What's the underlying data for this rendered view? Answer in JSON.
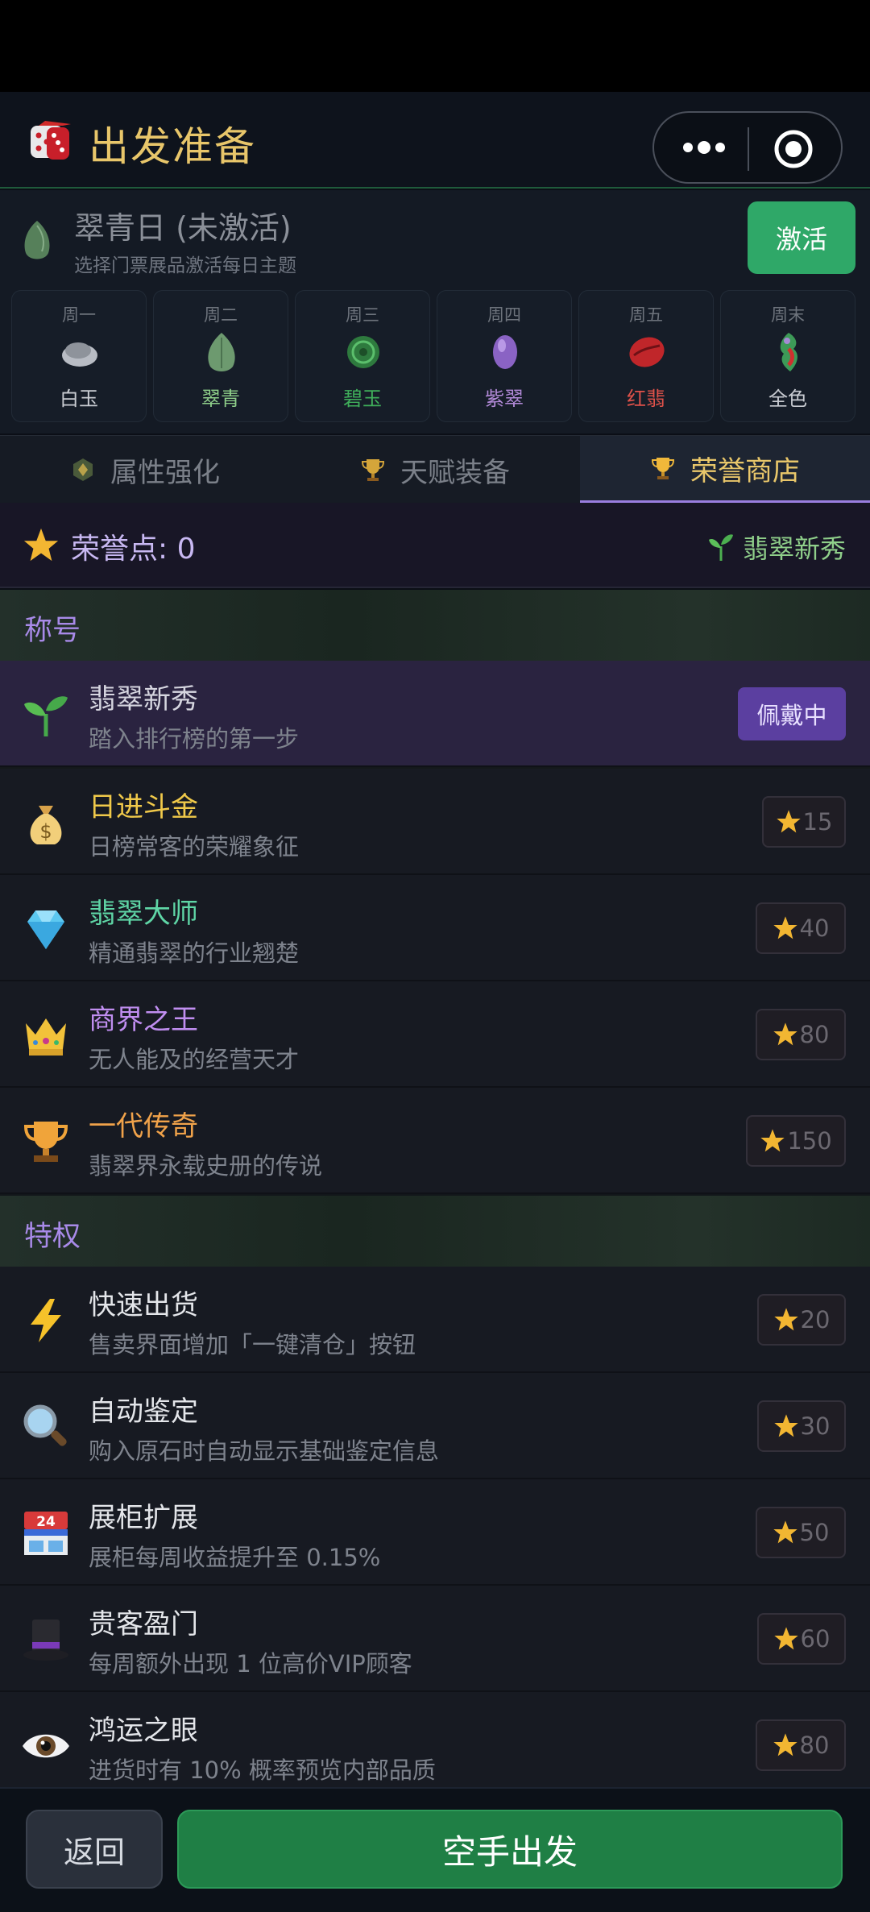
{
  "header": {
    "title": "出发准备"
  },
  "theme": {
    "name": "翠青日 (未激活)",
    "subtitle": "选择门票展品激活每日主题",
    "activate_label": "激活",
    "days": [
      {
        "day": "周一",
        "label": "白玉",
        "color": "#c9ccd2"
      },
      {
        "day": "周二",
        "label": "翠青",
        "color": "#8fcf8a"
      },
      {
        "day": "周三",
        "label": "碧玉",
        "color": "#3fae5a"
      },
      {
        "day": "周四",
        "label": "紫翠",
        "color": "#b28ad8"
      },
      {
        "day": "周五",
        "label": "红翡",
        "color": "#e0524a"
      },
      {
        "day": "周末",
        "label": "全色",
        "color": "#c9ccd2"
      }
    ]
  },
  "tabs": [
    {
      "label": "属性强化",
      "icon": "gear-gem-icon"
    },
    {
      "label": "天赋装备",
      "icon": "trophy-icon"
    },
    {
      "label": "荣誉商店",
      "icon": "trophy-icon",
      "active": true
    }
  ],
  "honor": {
    "points_label": "荣誉点: 0",
    "current_title": "翡翠新秀"
  },
  "titles_section": "称号",
  "titles": [
    {
      "name": "翡翠新秀",
      "desc": "踏入排行榜的第一步",
      "icon": "sprout-icon",
      "color": "#d6d6e0",
      "status": "佩戴中"
    },
    {
      "name": "日进斗金",
      "desc": "日榜常客的荣耀象征",
      "icon": "money-bag-icon",
      "color": "#f0c94a",
      "price": "15"
    },
    {
      "name": "翡翠大师",
      "desc": "精通翡翠的行业翘楚",
      "icon": "diamond-icon",
      "color": "#5fd6a6",
      "price": "40"
    },
    {
      "name": "商界之王",
      "desc": "无人能及的经营天才",
      "icon": "crown-icon",
      "color": "#c08ef0",
      "price": "80"
    },
    {
      "name": "一代传奇",
      "desc": "翡翠界永载史册的传说",
      "icon": "trophy-icon",
      "color": "#f0a24a",
      "price": "150"
    }
  ],
  "perks_section": "特权",
  "perks": [
    {
      "name": "快速出货",
      "desc": "售卖界面增加「一键清仓」按钮",
      "icon": "lightning-icon",
      "price": "20"
    },
    {
      "name": "自动鉴定",
      "desc": "购入原石时自动显示基础鉴定信息",
      "icon": "magnifier-icon",
      "price": "30"
    },
    {
      "name": "展柜扩展",
      "desc": "展柜每周收益提升至 0.15%",
      "icon": "store-24-icon",
      "price": "50"
    },
    {
      "name": "贵客盈门",
      "desc": "每周额外出现 1 位高价VIP顾客",
      "icon": "top-hat-icon",
      "price": "60"
    },
    {
      "name": "鸿运之眼",
      "desc": "进货时有 10% 概率预览内部品质",
      "icon": "eye-icon",
      "price": "80"
    }
  ],
  "footer": {
    "back_label": "返回",
    "go_label": "空手出发"
  }
}
